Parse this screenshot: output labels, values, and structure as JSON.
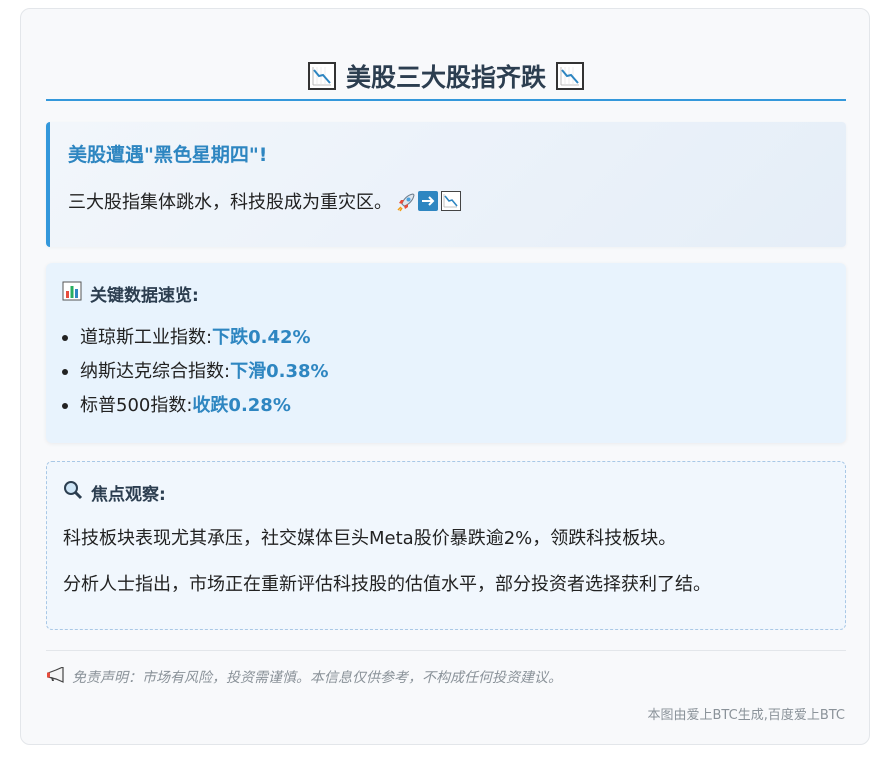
{
  "title": {
    "text": "美股三大股指齐跌",
    "left_icon": "chart-decreasing-icon",
    "right_icon": "chart-decreasing-icon"
  },
  "alert": {
    "heading": "美股遭遇\"黑色星期四\"!",
    "body": "三大股指集体跳水，科技股成为重灾区。",
    "icons": [
      "rocket-icon",
      "right-arrow-icon",
      "chart-decreasing-icon"
    ]
  },
  "key_data": {
    "heading": "关键数据速览:",
    "heading_icon": "bar-chart-icon",
    "items": [
      {
        "label": "道琼斯工业指数:",
        "value": "下跌0.42%"
      },
      {
        "label": "纳斯达克综合指数:",
        "value": "下滑0.38%"
      },
      {
        "label": "标普500指数:",
        "value": "收跌0.28%"
      }
    ]
  },
  "focus": {
    "heading": "焦点观察:",
    "heading_icon": "magnifier-icon",
    "paragraphs": [
      "科技板块表现尤其承压，社交媒体巨头Meta股价暴跌逾2%，领跌科技板块。",
      "分析人士指出，市场正在重新评估科技股的估值水平，部分投资者选择获利了结。"
    ]
  },
  "disclaimer": {
    "icon": "megaphone-icon",
    "text": "免责声明：市场有风险，投资需谨慎。本信息仅供参考，不构成任何投资建议。"
  },
  "footer": {
    "text": "本图由爱上BTC生成,百度爱上BTC"
  },
  "colors": {
    "accent": "#3498db",
    "value_text": "#2e86c1",
    "title_text": "#2c3e50"
  }
}
